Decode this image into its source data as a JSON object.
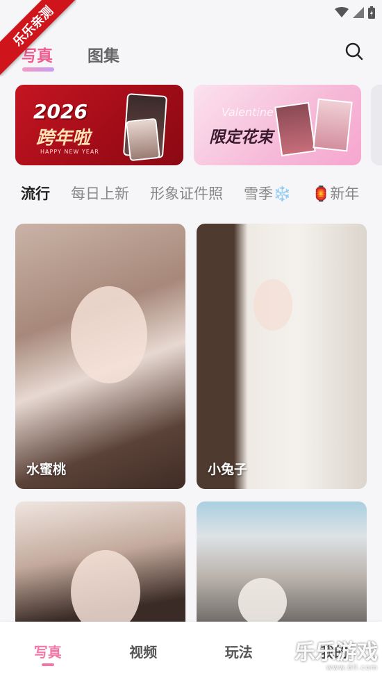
{
  "corner_badge": "乐乐亲测",
  "header": {
    "tabs": [
      {
        "label": "写真",
        "active": true
      },
      {
        "label": "图集",
        "active": false
      }
    ],
    "search_icon": "search-icon"
  },
  "banners": [
    {
      "year": "2026",
      "title": "跨年啦",
      "subtitle": "HAPPY NEW YEAR"
    },
    {
      "title": "限定花束",
      "deco": "Valentine"
    }
  ],
  "categories": [
    {
      "label": "流行",
      "active": true
    },
    {
      "label": "每日上新",
      "active": false
    },
    {
      "label": "形象证件照",
      "active": false
    },
    {
      "label": "雪季❄️",
      "active": false
    },
    {
      "label": "🏮新年",
      "active": false
    }
  ],
  "cards": [
    {
      "label": "水蜜桃"
    },
    {
      "label": "小兔子"
    },
    {
      "label": ""
    },
    {
      "label": ""
    }
  ],
  "bottom_nav": [
    {
      "label": "写真",
      "active": true
    },
    {
      "label": "视频",
      "active": false
    },
    {
      "label": "玩法",
      "active": false
    },
    {
      "label": "我的",
      "active": false
    }
  ],
  "watermark": {
    "title": "乐乐游戏",
    "url": "www.6ll.com"
  },
  "colors": {
    "accent": "#f07aa7",
    "badge_red": "#d0141c"
  }
}
